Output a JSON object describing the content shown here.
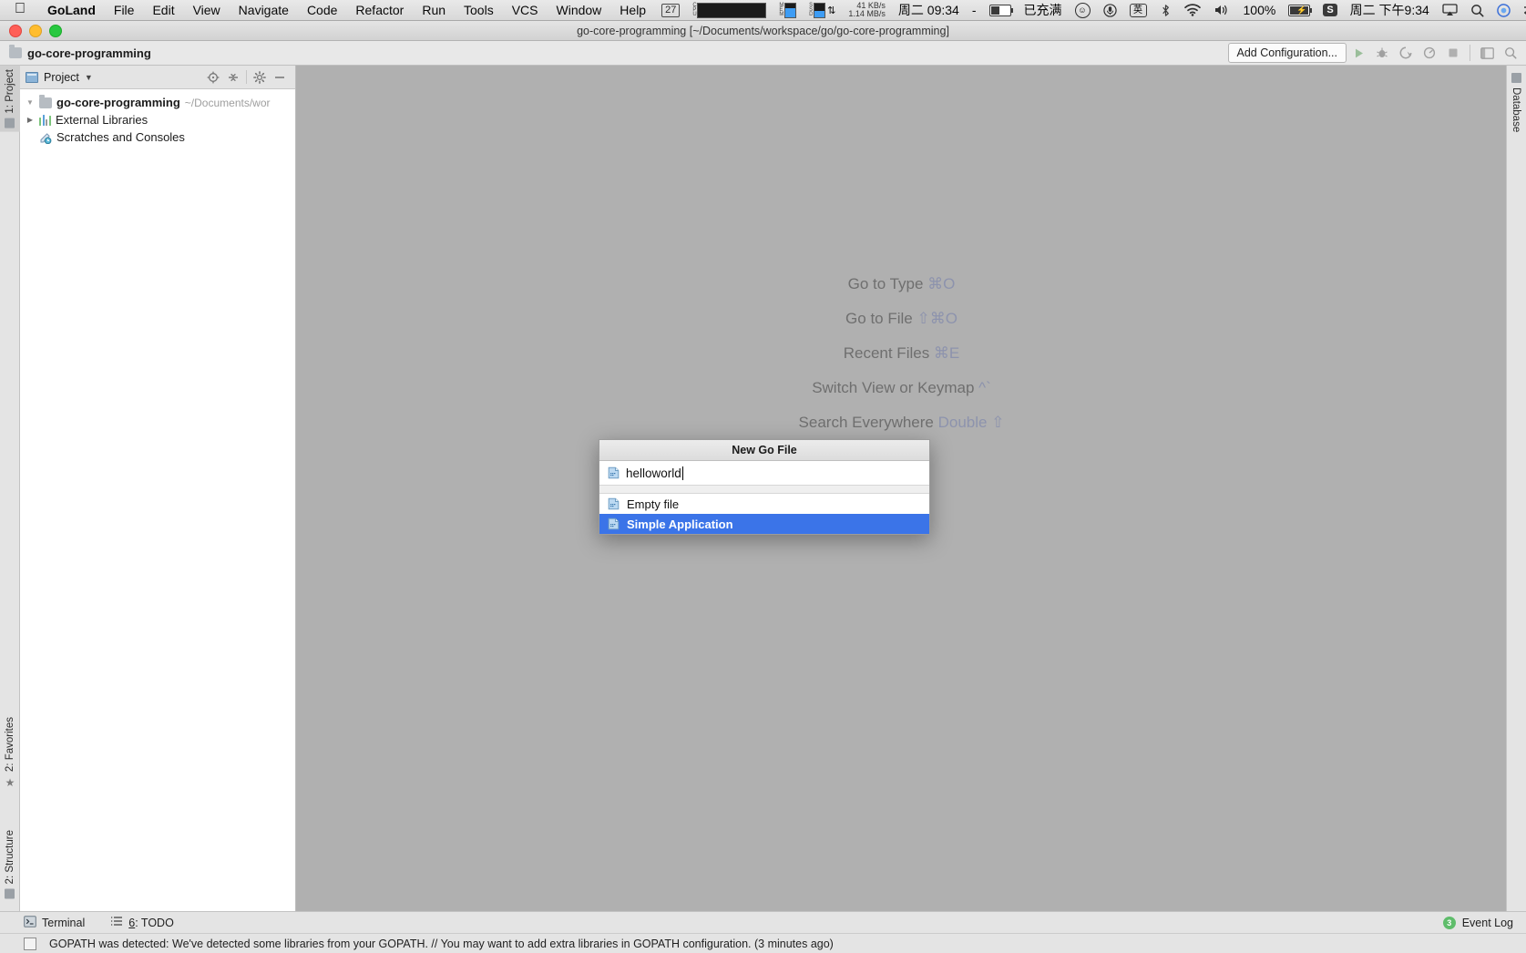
{
  "menubar": {
    "apple": "apple-logo",
    "items": [
      {
        "label": "GoLand",
        "bold": true
      },
      {
        "label": "File"
      },
      {
        "label": "Edit"
      },
      {
        "label": "View"
      },
      {
        "label": "Navigate"
      },
      {
        "label": "Code"
      },
      {
        "label": "Refactor"
      },
      {
        "label": "Run"
      },
      {
        "label": "Tools"
      },
      {
        "label": "VCS"
      },
      {
        "label": "Window"
      },
      {
        "label": "Help"
      }
    ],
    "status": {
      "counter_badge": "27",
      "cpu_label": "CPU",
      "mem_label": "MEM",
      "ssd_label": "SSD",
      "net_down": "41 KB/s",
      "net_up": "1.14 MB/s",
      "date_time": "周二 09:34",
      "dash": "-",
      "battery_status": "已充满",
      "smiley": "☺",
      "mic": "mic-icon",
      "input_method": "英",
      "bluetooth": "bluetooth-icon",
      "wifi": "wifi-icon",
      "volume": "volume-icon",
      "battery_percent": "100%",
      "battery_icon": "battery-charging-icon",
      "sogou": "S",
      "clock": "周二 下午9:34",
      "airplay": "airplay-icon",
      "spotlight": "search-icon",
      "siri": "siri-icon",
      "controlcenter": "control-center-icon",
      "menu_extras": "menu-extras-icon"
    }
  },
  "window": {
    "title": "go-core-programming [~/Documents/workspace/go/go-core-programming]"
  },
  "navbar": {
    "project_name": "go-core-programming",
    "add_configuration": "Add Configuration...",
    "run_icon": "run-icon",
    "debug_icon": "debug-icon",
    "coverage_icon": "run-with-coverage-icon",
    "profile_icon": "profile-icon",
    "stop_icon": "stop-icon",
    "layout_icon": "restore-layout-icon",
    "search_icon": "search-everywhere-icon"
  },
  "sidebar": {
    "header": {
      "icon": "project-view-icon",
      "title": "Project",
      "caret": "chevron-down-icon",
      "locate_icon": "locate-icon",
      "collapse_icon": "collapse-all-icon",
      "settings_icon": "gear-icon",
      "hide_icon": "hide-icon"
    },
    "tree": [
      {
        "label": "go-core-programming",
        "path": "~/Documents/wor",
        "arrow": "expanded",
        "icon": "folder-icon",
        "bold": true
      },
      {
        "label": "External Libraries",
        "path": "",
        "arrow": "collapsed",
        "icon": "libraries-icon",
        "bold": false
      },
      {
        "label": "Scratches and Consoles",
        "path": "",
        "arrow": "none",
        "icon": "scratches-icon",
        "bold": false
      }
    ]
  },
  "left_tabs": [
    {
      "label": "1: Project",
      "icon": "project-icon",
      "selected": true
    },
    {
      "label": "2: Favorites",
      "icon": "star-icon",
      "selected": false
    },
    {
      "label": "2: Structure",
      "icon": "structure-icon",
      "selected": false
    }
  ],
  "right_tabs": [
    {
      "label": "Database",
      "icon": "database-icon"
    }
  ],
  "editor": {
    "hints": [
      {
        "text": "Go to Type ",
        "key": "⌘O"
      },
      {
        "text": "Go to File ",
        "key": "⇧⌘O"
      },
      {
        "text": "Recent Files ",
        "key": "⌘E"
      },
      {
        "text": "Switch View or Keymap ",
        "key": "^`"
      },
      {
        "text": "Search Everywhere ",
        "key": "Double ⇧"
      }
    ]
  },
  "dialog": {
    "title": "New Go File",
    "input_value": "helloworld",
    "input_icon": "go-file-icon",
    "items": [
      {
        "label": "Empty file",
        "icon": "go-file-icon",
        "selected": false
      },
      {
        "label": "Simple Application",
        "icon": "go-file-icon",
        "selected": true
      }
    ],
    "selection_color": "#3b74e8"
  },
  "bottom_bar": {
    "terminal": {
      "label": "Terminal",
      "icon": "terminal-icon"
    },
    "todo": {
      "prefix": "6",
      "label": ": TODO",
      "icon": "todo-icon"
    },
    "event_log": {
      "label": "Event Log",
      "count": "3",
      "color": "#5fbd6b"
    }
  },
  "status_bar": {
    "message": "GOPATH was detected: We've detected some libraries from your GOPATH. // You may want to add extra libraries in GOPATH configuration. (3 minutes ago)"
  }
}
